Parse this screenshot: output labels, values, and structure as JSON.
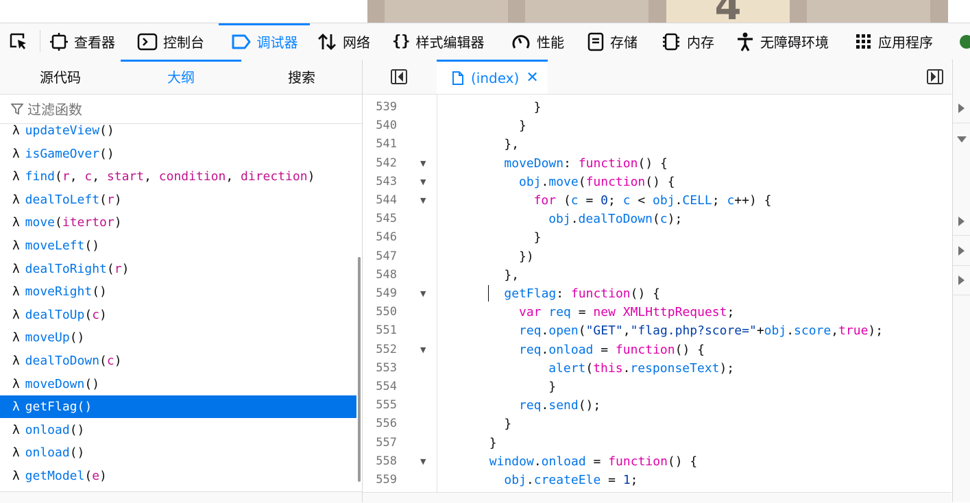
{
  "game": {
    "tile_value": "4"
  },
  "toolbar": {
    "inspector": "查看器",
    "console": "控制台",
    "debugger": "调试器",
    "network": "网络",
    "style_editor": "样式编辑器",
    "performance": "性能",
    "storage": "存储",
    "memory": "内存",
    "accessibility": "无障碍环境",
    "application": "应用程序",
    "active_color": "#0a84ff"
  },
  "left_panel": {
    "tabs": [
      "源代码",
      "大纲",
      "搜索"
    ],
    "active_tab": "大纲",
    "filter_placeholder": "过滤函数",
    "outline": [
      {
        "name": "updateView",
        "params": []
      },
      {
        "name": "isGameOver",
        "params": []
      },
      {
        "name": "find",
        "params": [
          "r",
          "c",
          "start",
          "condition",
          "direction"
        ]
      },
      {
        "name": "dealToLeft",
        "params": [
          "r"
        ]
      },
      {
        "name": "move",
        "params": [
          "itertor"
        ]
      },
      {
        "name": "moveLeft",
        "params": []
      },
      {
        "name": "dealToRight",
        "params": [
          "r"
        ]
      },
      {
        "name": "moveRight",
        "params": []
      },
      {
        "name": "dealToUp",
        "params": [
          "c"
        ]
      },
      {
        "name": "moveUp",
        "params": []
      },
      {
        "name": "dealToDown",
        "params": [
          "c"
        ]
      },
      {
        "name": "moveDown",
        "params": []
      },
      {
        "name": "getFlag",
        "params": [],
        "selected": true
      },
      {
        "name": "onload",
        "params": []
      },
      {
        "name": "onload",
        "params": []
      },
      {
        "name": "getModel",
        "params": [
          "e"
        ]
      }
    ]
  },
  "editor": {
    "tab_label": "(index)",
    "lines": [
      {
        "n": "539",
        "indent": 6,
        "fold": false,
        "tokens": [
          [
            "}",
            "d"
          ]
        ]
      },
      {
        "n": "540",
        "indent": 5,
        "fold": false,
        "tokens": [
          [
            "}",
            "d"
          ]
        ]
      },
      {
        "n": "541",
        "indent": 4,
        "fold": false,
        "tokens": [
          [
            "},",
            "d"
          ]
        ]
      },
      {
        "n": "542",
        "indent": 4,
        "fold": true,
        "tokens": [
          [
            "moveDown",
            "p"
          ],
          [
            ": ",
            "d"
          ],
          [
            "function",
            "k"
          ],
          [
            "() {",
            "d"
          ]
        ]
      },
      {
        "n": "543",
        "indent": 5,
        "fold": true,
        "tokens": [
          [
            "obj",
            "p"
          ],
          [
            ".",
            "d"
          ],
          [
            "move",
            "p"
          ],
          [
            "(",
            "d"
          ],
          [
            "function",
            "k"
          ],
          [
            "() {",
            "d"
          ]
        ]
      },
      {
        "n": "544",
        "indent": 6,
        "fold": true,
        "tokens": [
          [
            "for",
            "k"
          ],
          [
            " (",
            "d"
          ],
          [
            "c",
            "p"
          ],
          [
            " = ",
            "d"
          ],
          [
            "0",
            "s"
          ],
          [
            "; ",
            "d"
          ],
          [
            "c",
            "p"
          ],
          [
            " < ",
            "d"
          ],
          [
            "obj",
            "p"
          ],
          [
            ".",
            "d"
          ],
          [
            "CELL",
            "p"
          ],
          [
            "; ",
            "d"
          ],
          [
            "c",
            "p"
          ],
          [
            "++) {",
            "d"
          ]
        ]
      },
      {
        "n": "545",
        "indent": 7,
        "fold": false,
        "tokens": [
          [
            "obj",
            "p"
          ],
          [
            ".",
            "d"
          ],
          [
            "dealToDown",
            "p"
          ],
          [
            "(",
            "d"
          ],
          [
            "c",
            "p"
          ],
          [
            ");",
            "d"
          ]
        ]
      },
      {
        "n": "546",
        "indent": 6,
        "fold": false,
        "tokens": [
          [
            "}",
            "d"
          ]
        ]
      },
      {
        "n": "547",
        "indent": 5,
        "fold": false,
        "tokens": [
          [
            "})",
            "d"
          ]
        ]
      },
      {
        "n": "548",
        "indent": 4,
        "fold": false,
        "tokens": [
          [
            "},",
            "d"
          ]
        ]
      },
      {
        "n": "549",
        "indent": 4,
        "fold": true,
        "tokens": [
          [
            "getFlag",
            "p"
          ],
          [
            ": ",
            "d"
          ],
          [
            "function",
            "k"
          ],
          [
            "() {",
            "d"
          ]
        ]
      },
      {
        "n": "550",
        "indent": 5,
        "fold": false,
        "tokens": [
          [
            "var",
            "k"
          ],
          [
            " ",
            "d"
          ],
          [
            "req",
            "p"
          ],
          [
            " = ",
            "d"
          ],
          [
            "new",
            "k"
          ],
          [
            " ",
            "d"
          ],
          [
            "XMLHttpRequest",
            "k"
          ],
          [
            ";",
            "d"
          ]
        ]
      },
      {
        "n": "551",
        "indent": 5,
        "fold": false,
        "tokens": [
          [
            "req",
            "p"
          ],
          [
            ".",
            "d"
          ],
          [
            "open",
            "p"
          ],
          [
            "(",
            "d"
          ],
          [
            "\"GET\"",
            "s"
          ],
          [
            ",",
            "d"
          ],
          [
            "\"flag.php?score=\"",
            "s"
          ],
          [
            "+",
            "d"
          ],
          [
            "obj",
            "p"
          ],
          [
            ".",
            "d"
          ],
          [
            "score",
            "p"
          ],
          [
            ",",
            "d"
          ],
          [
            "true",
            "k"
          ],
          [
            ");",
            "d"
          ]
        ]
      },
      {
        "n": "552",
        "indent": 5,
        "fold": true,
        "tokens": [
          [
            "req",
            "p"
          ],
          [
            ".",
            "d"
          ],
          [
            "onload",
            "p"
          ],
          [
            " = ",
            "d"
          ],
          [
            "function",
            "k"
          ],
          [
            "() {",
            "d"
          ]
        ]
      },
      {
        "n": "553",
        "indent": 7,
        "fold": false,
        "tokens": [
          [
            "alert",
            "p"
          ],
          [
            "(",
            "d"
          ],
          [
            "this",
            "k"
          ],
          [
            ".",
            "d"
          ],
          [
            "responseText",
            "p"
          ],
          [
            ");",
            "d"
          ]
        ]
      },
      {
        "n": "554",
        "indent": 7,
        "fold": false,
        "tokens": [
          [
            "}",
            "d"
          ]
        ]
      },
      {
        "n": "555",
        "indent": 5,
        "fold": false,
        "tokens": [
          [
            "req",
            "p"
          ],
          [
            ".",
            "d"
          ],
          [
            "send",
            "p"
          ],
          [
            "();",
            "d"
          ]
        ]
      },
      {
        "n": "556",
        "indent": 4,
        "fold": false,
        "tokens": [
          [
            "}",
            "d"
          ]
        ]
      },
      {
        "n": "557",
        "indent": 3,
        "fold": false,
        "tokens": [
          [
            "}",
            "d"
          ]
        ]
      },
      {
        "n": "558",
        "indent": 3,
        "fold": true,
        "tokens": [
          [
            "window",
            "p"
          ],
          [
            ".",
            "d"
          ],
          [
            "onload",
            "p"
          ],
          [
            " = ",
            "d"
          ],
          [
            "function",
            "k"
          ],
          [
            "() {",
            "d"
          ]
        ]
      },
      {
        "n": "559",
        "indent": 4,
        "fold": false,
        "tokens": [
          [
            "obj",
            "p"
          ],
          [
            ".",
            "d"
          ],
          [
            "createEle",
            "p"
          ],
          [
            " = ",
            "d"
          ],
          [
            "1",
            "s"
          ],
          [
            ";",
            "d"
          ]
        ]
      }
    ]
  }
}
